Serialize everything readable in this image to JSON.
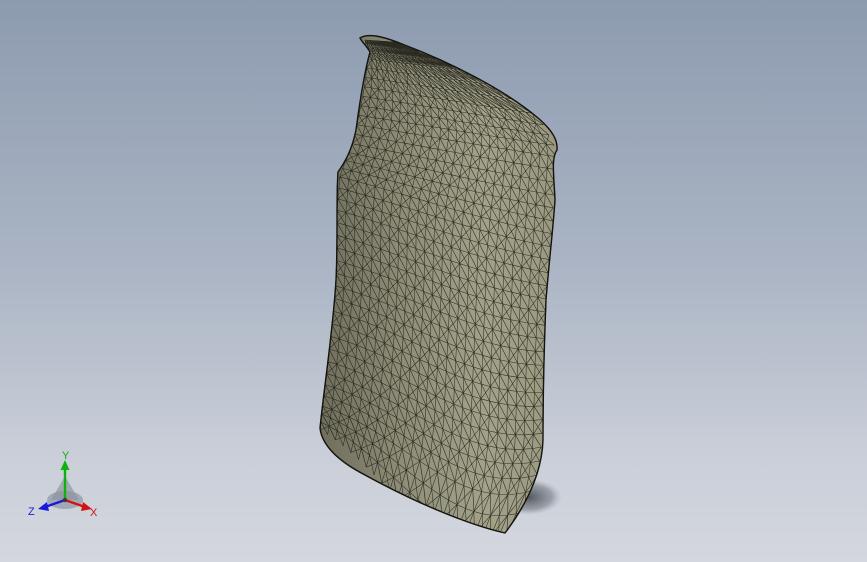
{
  "viewport": {
    "background_top": "#8d9bb0",
    "background_bottom": "#d4d7de"
  },
  "model": {
    "type": "triangulated surface mesh",
    "fill_color": "#8a8a74",
    "edge_color": "#1a1a14"
  },
  "triad": {
    "axes": [
      {
        "name": "X",
        "label": "X",
        "color": "#d21414"
      },
      {
        "name": "Y",
        "label": "Y",
        "color": "#10b010"
      },
      {
        "name": "Z",
        "label": "Z",
        "color": "#1a1ad8"
      }
    ]
  }
}
